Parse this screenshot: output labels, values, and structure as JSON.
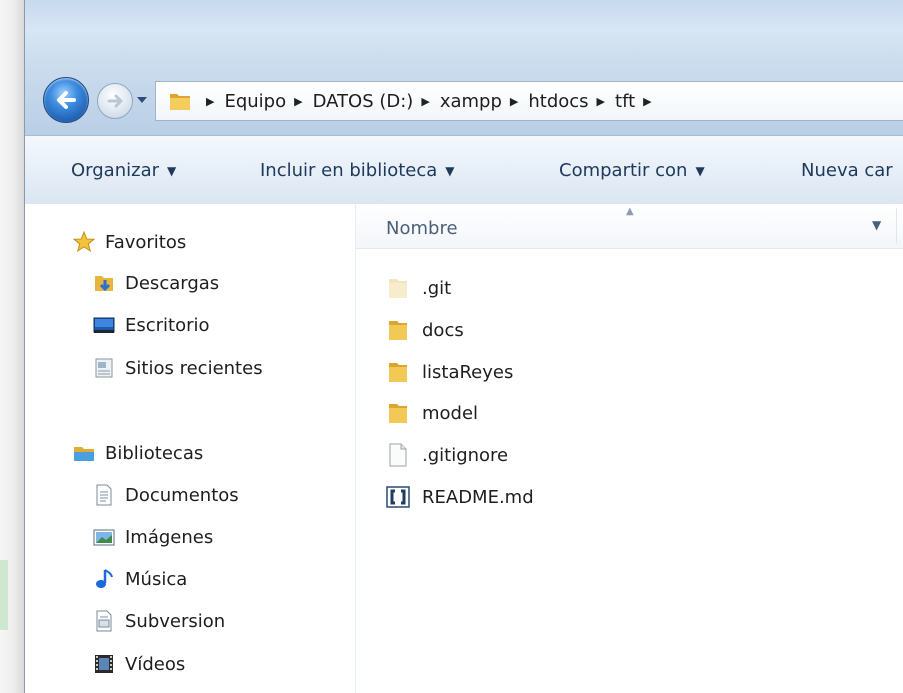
{
  "address": {
    "crumbs": [
      "Equipo",
      "DATOS (D:)",
      "xampp",
      "htdocs",
      "tft"
    ]
  },
  "toolbar": {
    "organize": "Organizar",
    "include": "Incluir en biblioteca",
    "share": "Compartir con",
    "newfolder": "Nueva car"
  },
  "nav": {
    "favorites": "Favoritos",
    "downloads": "Descargas",
    "desktop": "Escritorio",
    "recent": "Sitios recientes",
    "libraries": "Bibliotecas",
    "documents": "Documentos",
    "images": "Imágenes",
    "music": "Música",
    "subversion": "Subversion",
    "videos": "Vídeos"
  },
  "content": {
    "column_name": "Nombre",
    "files": [
      {
        "name": ".git",
        "icon": "folder-faded-icon"
      },
      {
        "name": "docs",
        "icon": "folder-icon"
      },
      {
        "name": "listaReyes",
        "icon": "folder-icon"
      },
      {
        "name": "model",
        "icon": "folder-icon"
      },
      {
        "name": ".gitignore",
        "icon": "text-file-icon"
      },
      {
        "name": "README.md",
        "icon": "markdown-file-icon"
      }
    ]
  },
  "colors": {
    "toolbar_text": "#1e395b",
    "column_header_text": "#4c607a",
    "folder": "#e8b73a"
  }
}
